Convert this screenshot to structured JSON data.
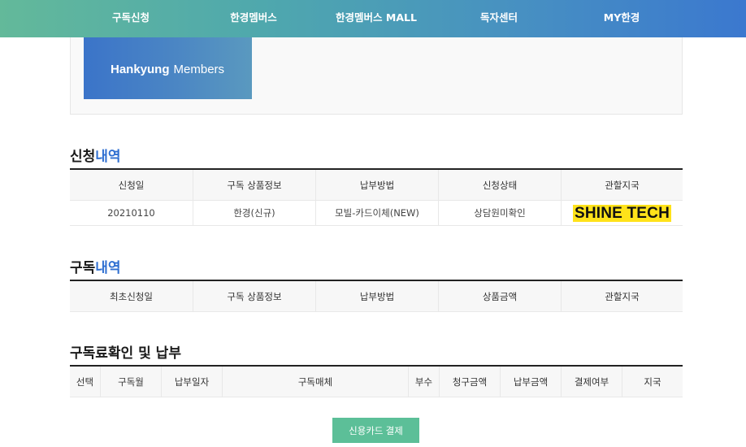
{
  "nav": {
    "items": [
      {
        "label": "구독신청"
      },
      {
        "label": "한경멤버스"
      },
      {
        "label": "한경멤버스 MALL"
      },
      {
        "label": "독자센터"
      },
      {
        "label": "MY한경"
      }
    ]
  },
  "banner": {
    "brand_bold": "Hankyung",
    "brand_light": "Members"
  },
  "application": {
    "title_main": "신청",
    "title_accent": "내역",
    "headers": [
      "신청일",
      "구독 상품정보",
      "납부방법",
      "신청상태",
      "관할지국"
    ],
    "rows": [
      {
        "date": "20210110",
        "product": "한경(신규)",
        "payment": "모빌-카드이체(NEW)",
        "status": "상담원미확인",
        "branch": "SHINE TECH"
      }
    ]
  },
  "subscription": {
    "title_main": "구독",
    "title_accent": "내역",
    "headers": [
      "최초신청일",
      "구독 상품정보",
      "납부방법",
      "상품금액",
      "관할지국"
    ]
  },
  "fee": {
    "title": "구독료확인 및 납부",
    "headers": [
      "선택",
      "구독월",
      "납부일자",
      "구독매체",
      "부수",
      "청구금액",
      "납부금액",
      "결제여부",
      "지국"
    ]
  },
  "pay_button": {
    "label": "신용카드 결제"
  },
  "colors": {
    "accent": "#2f6fd1",
    "button": "#5cbf98",
    "highlight": "#ffe21a"
  }
}
